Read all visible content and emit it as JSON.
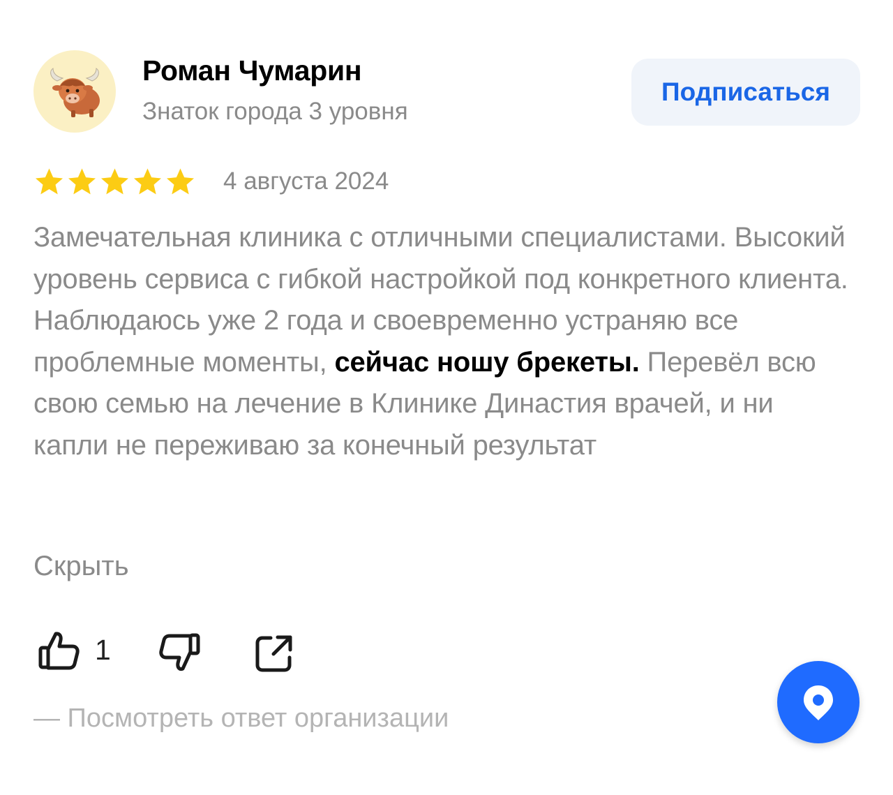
{
  "author": {
    "name": "Роман Чумарин",
    "level": "Знаток города 3 уровня",
    "avatar_icon": "yak-avatar-icon"
  },
  "subscribe_label": "Подписаться",
  "review": {
    "rating": 5,
    "rating_max": 5,
    "date": "4 августа 2024",
    "text_before_bold": "Замечательная клиника с отличными специалистами. Высокий уровень сервиса с гибкой настройкой под конкретного клиента. Наблюдаюсь уже 2 года и своевременно устраняю все проблемные моменты, ",
    "text_bold": "сейчас ношу брекеты.",
    "text_after_bold": " Перевёл всю свою семью на лечение в Клинике Династия врачей, и ни капли не переживаю за конечный результат",
    "hide_label": "Скрыть"
  },
  "actions": {
    "like_count": "1",
    "like_icon": "thumbs-up-icon",
    "dislike_icon": "thumbs-down-icon",
    "share_icon": "share-icon"
  },
  "org_reply_label": "— Посмотреть ответ организации",
  "fab_icon": "map-pin-icon",
  "colors": {
    "accent": "#1a66e6",
    "fab": "#1f6bff",
    "star": "#fccc14",
    "muted_text": "#8a8a8a",
    "subscribe_bg": "#f0f4fa"
  }
}
